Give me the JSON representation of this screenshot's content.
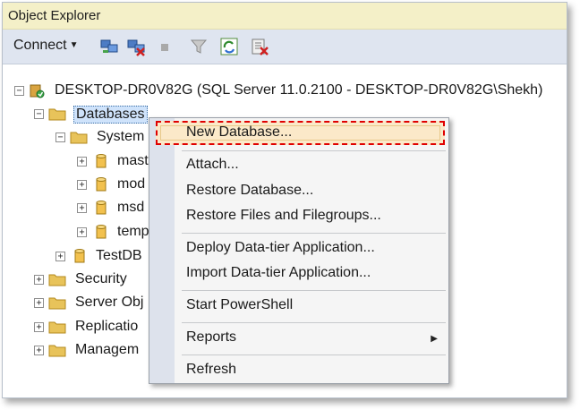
{
  "window": {
    "title": "Object Explorer"
  },
  "toolbar": {
    "connect_label": "Connect",
    "icons": [
      "connect-server-icon",
      "disconnect-server-icon",
      "stop-icon",
      "filter-icon",
      "refresh-icon",
      "summary-icon"
    ]
  },
  "tree": {
    "server": "DESKTOP-DR0V82G (SQL Server 11.0.2100 - DESKTOP-DR0V82G\\Shekh)",
    "databases": "Databases",
    "system": "System",
    "sysdbs": [
      "mast",
      "mod",
      "msd",
      "temp"
    ],
    "testdb": "TestDB",
    "security": "Security",
    "server_obj": "Server Obj",
    "replication": "Replicatio",
    "management": "Managem"
  },
  "context_menu": {
    "items": [
      "New Database...",
      "Attach...",
      "Restore Database...",
      "Restore Files and Filegroups...",
      "Deploy Data-tier Application...",
      "Import Data-tier Application...",
      "Start PowerShell",
      "Reports",
      "Refresh"
    ],
    "highlighted_item": "New Database..."
  },
  "colors": {
    "highlight_border": "#e00000",
    "title_bg": "#f4f0c8",
    "toolbar_bg": "#dfe5f0"
  }
}
